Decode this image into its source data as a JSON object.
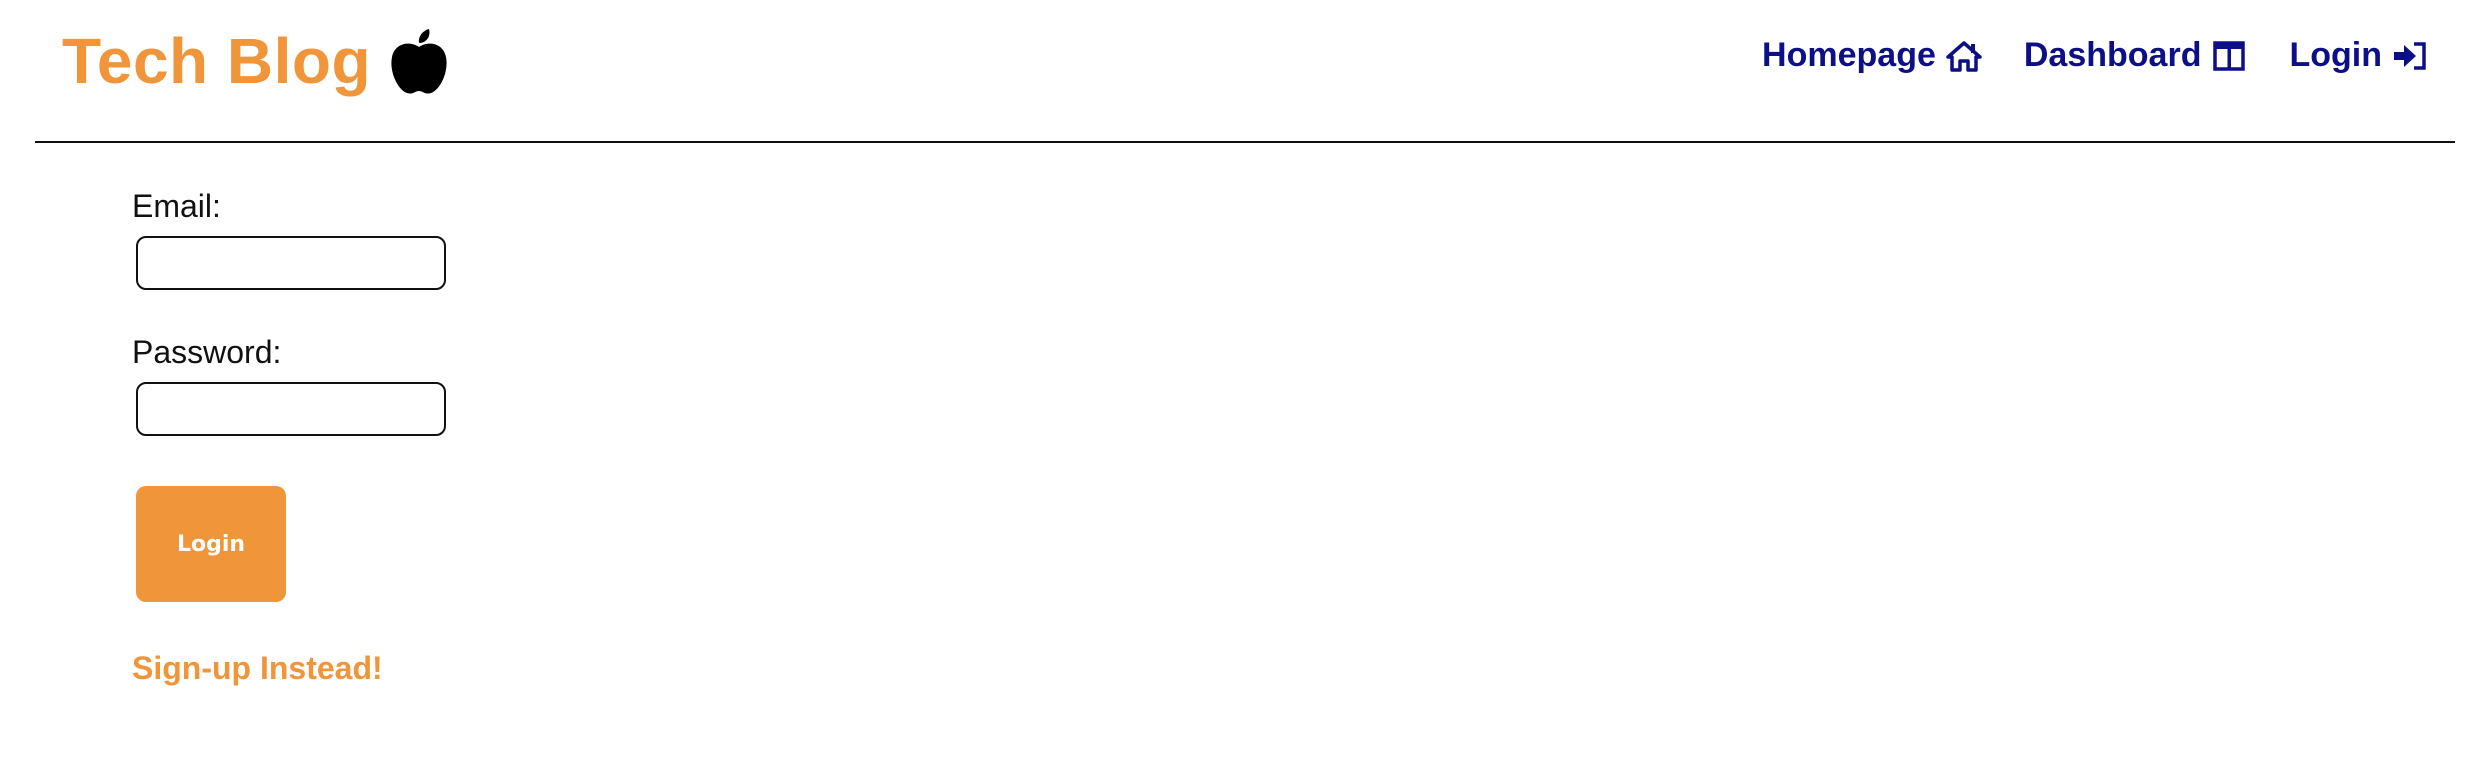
{
  "header": {
    "brand_title": "Tech Blog",
    "brand_icon": "apple-icon",
    "nav": [
      {
        "label": "Homepage",
        "icon": "home-icon"
      },
      {
        "label": "Dashboard",
        "icon": "columns-icon"
      },
      {
        "label": "Login",
        "icon": "sign-in-icon"
      }
    ]
  },
  "form": {
    "email_label": "Email:",
    "email_value": "",
    "password_label": "Password:",
    "password_value": "",
    "login_button": "Login",
    "signup_link": "Sign-up Instead!"
  },
  "colors": {
    "brand": "#f0953a",
    "nav": "#0d0f86",
    "button_text": "#ffffff"
  }
}
